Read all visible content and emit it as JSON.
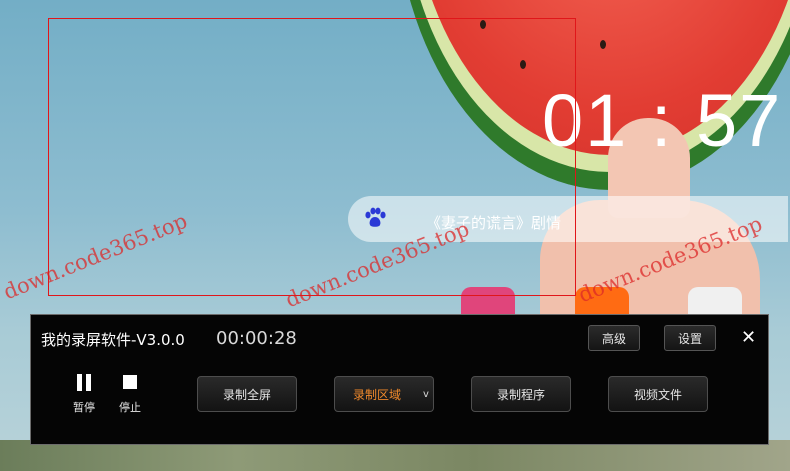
{
  "wallpaper": {
    "clock": "01 : 57",
    "search_text": "《妻子的谎言》剧情",
    "watermarks": [
      "down.code365.top",
      "down.code365.top",
      "down.code365.top"
    ]
  },
  "recorder": {
    "title": "我的录屏软件-V3.0.0",
    "timer": "00:00:28",
    "buttons": {
      "advanced": "高级",
      "settings": "设置",
      "close": "✕",
      "pause": "暂停",
      "stop": "停止",
      "record_fullscreen": "录制全屏",
      "record_region": "录制区域",
      "region_dropdown": "v",
      "record_program": "录制程序",
      "video_files": "视频文件"
    },
    "colors": {
      "selection_border": "#e0161a",
      "active_button_text": "#f0892b",
      "panel_bg": "#050505"
    }
  }
}
